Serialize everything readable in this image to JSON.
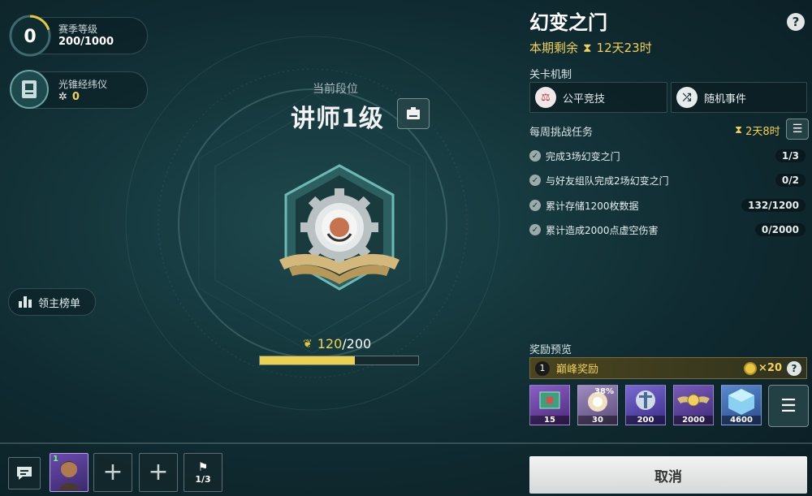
{
  "season": {
    "level": "0",
    "label": "赛季等级",
    "progress": "200/1000",
    "progress_fraction": 0.2
  },
  "device": {
    "label": "光锥经纬仪",
    "value": "0"
  },
  "leaderboard": {
    "label": "领主榜单"
  },
  "rank": {
    "caption": "当前段位",
    "title": "讲师1级",
    "points_current": "120",
    "points_sep": "/200",
    "points_fraction": 0.6
  },
  "panel": {
    "title": "幻变之门",
    "help": "?",
    "remaining_label": "本期剩余",
    "remaining_time": "12天23时",
    "mechanics_label": "关卡机制",
    "mechanics": [
      {
        "label": "公平竞技",
        "icon": "scales-icon"
      },
      {
        "label": "随机事件",
        "icon": "shuffle-icon"
      }
    ],
    "weekly_label": "每周挑战任务",
    "weekly_time": "2天8时",
    "tasks": [
      {
        "label": "完成3场幻变之门",
        "count": "1/3"
      },
      {
        "label": "与好友组队完成2场幻变之门",
        "count": "0/2"
      },
      {
        "label": "累计存储1200枚数据",
        "count": "132/1200"
      },
      {
        "label": "累计造成2000点虚空伤害",
        "count": "0/2000"
      }
    ],
    "reward_preview_label": "奖励预览",
    "reward_tier_num": "1",
    "reward_tier_label": "巅峰奖励",
    "reward_coin": "×20",
    "rewards": [
      {
        "qty": "15",
        "color": "#6a3fa8"
      },
      {
        "qty": "30",
        "color": "#8a6fb0",
        "badge": "38%"
      },
      {
        "qty": "200",
        "color": "#5a4aa8"
      },
      {
        "qty": "2000",
        "color": "#6a4aa0"
      },
      {
        "qty": "4600",
        "color": "#3a6ab0"
      }
    ],
    "cancel_label": "取消"
  },
  "bottom": {
    "flag_count": "1/3",
    "avatar_level": "1"
  }
}
